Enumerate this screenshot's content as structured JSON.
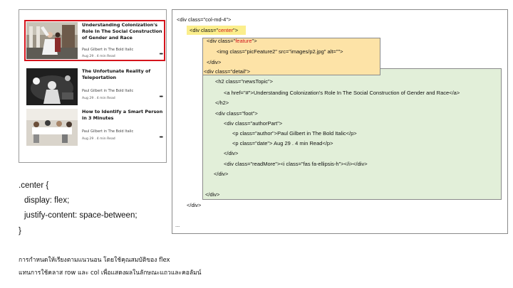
{
  "annotations": {
    "feature": "feature",
    "detail": "detail"
  },
  "posts": [
    {
      "title": "Understanding Colonization's Role In The Social Construction of Gender and Race",
      "author": "Paul Gilbert in The Bold Italic",
      "date": "Aug 29 . 4 min Read",
      "more": "•••"
    },
    {
      "title": "The Unfortunate Reality of Teleportation",
      "author": "Paul Gilbert in The Bold Italic",
      "date": "Aug 29 . 4 min Read",
      "more": "•••"
    },
    {
      "title": "How to Identify a Smart Person in 3 Minutes",
      "author": "Paul Gilbert in The Bold Italic",
      "date": "Aug 29 . 4 min Read",
      "more": "•••"
    }
  ],
  "css_rule": [
    ".center {",
    "display: flex;",
    "justify-content: space-between;",
    "}"
  ],
  "thai_text": [
    "การกำหนดให้เรียงตามแนวนอน โดยใช้คุณสมบัติของ flex",
    "แทนการใช้คลาส row และ col เพื่อแสดงผลในลักษณะแถวและคอลัมน์"
  ],
  "code": {
    "l1": "<div class=\"col-md-4\">",
    "l2a": "<div class=\"",
    "l2b": "center",
    "l2c": "\">",
    "l3a": "<div class=\"",
    "l3b": "feature",
    "l3c": "\">",
    "l4": "<img class=\"picFeature2\" src=\"images/p2.jpg\" alt=\"\">",
    "l5": "</div>",
    "l6": "<div class=\"detail\">",
    "l7": "<h2 class=\"newsTopic\">",
    "l8": "<a href=\"#\">Understanding Colonization's Role In The Social Construction of Gender and Race</a>",
    "l9": "</h2>",
    "l10": "<div class=\"foot\">",
    "l11": "<div class=\"authorPart\">",
    "l12": "<p class=\"author\">Paul Gilbert in The Bold Italic</p>",
    "l13": "<p class=\"date\"> Aug 29 . 4 min Read</p>",
    "l14": "</div>",
    "l15": "<div class=\"readMore\"><i class=\"fas fa-ellipsis-h\"></i></div>",
    "l16": "</div>",
    "l17": "</div>",
    "l18": "</div>",
    "l19": "..."
  }
}
